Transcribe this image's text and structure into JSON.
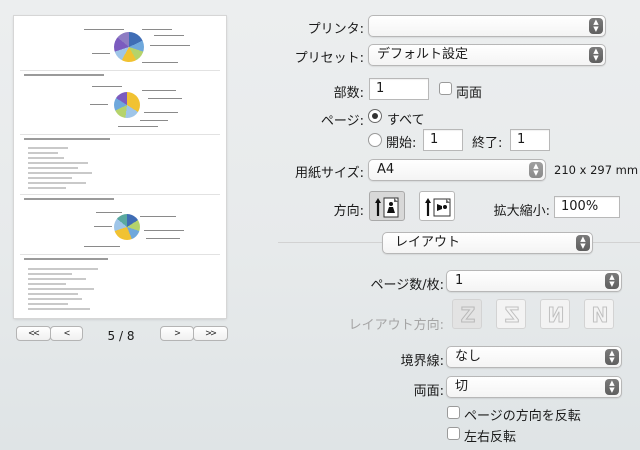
{
  "preview": {
    "page_indicator": "5 / 8",
    "first_label": "<<",
    "prev_label": "<",
    "next_label": ">",
    "last_label": ">>"
  },
  "printer": {
    "label": "プリンタ:",
    "value": ""
  },
  "presets": {
    "label": "プリセット:",
    "value": "デフォルト設定"
  },
  "copies": {
    "label": "部数:",
    "value": "1",
    "two_sided_label": "両面"
  },
  "pages": {
    "label": "ページ:",
    "all_label": "すべて",
    "from_label": "開始:",
    "from_value": "1",
    "to_label": "終了:",
    "to_value": "1"
  },
  "paper_size": {
    "label": "用紙サイズ:",
    "value": "A4",
    "dimensions": "210 x 297 mm"
  },
  "orientation": {
    "label": "方向:"
  },
  "scale": {
    "label": "拡大縮小:",
    "value": "100%"
  },
  "section": {
    "value": "レイアウト"
  },
  "pages_per_sheet": {
    "label": "ページ数/枚:",
    "value": "1"
  },
  "layout_direction": {
    "label": "レイアウト方向:"
  },
  "border": {
    "label": "境界線:",
    "value": "なし"
  },
  "two_sided": {
    "label": "両面:",
    "value": "切"
  },
  "reverse_orientation": {
    "label": "ページの方向を反転"
  },
  "flip_horizontally": {
    "label": "左右反転"
  },
  "colors": {
    "accent_stepper": "#6b6b6b",
    "selected_button": "#d8d8d8"
  }
}
